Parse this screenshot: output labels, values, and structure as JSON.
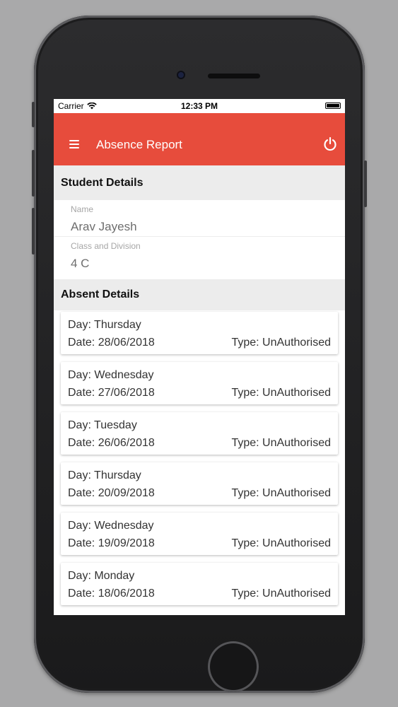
{
  "status_bar": {
    "carrier": "Carrier",
    "time": "12:33 PM"
  },
  "app_bar": {
    "title": "Absence Report",
    "menu_icon": "hamburger-menu-icon",
    "power_icon": "power-icon"
  },
  "student_details": {
    "header": "Student Details",
    "name_label": "Name",
    "name_value": "Arav Jayesh",
    "class_label": "Class and Division",
    "class_value": "4 C"
  },
  "absent_details": {
    "header": "Absent Details",
    "records": [
      {
        "day": "Day: Thursday",
        "date": "Date: 28/06/2018",
        "type": "Type: UnAuthorised"
      },
      {
        "day": "Day: Wednesday",
        "date": "Date: 27/06/2018",
        "type": "Type: UnAuthorised"
      },
      {
        "day": "Day: Tuesday",
        "date": "Date: 26/06/2018",
        "type": "Type: UnAuthorised"
      },
      {
        "day": "Day: Thursday",
        "date": "Date: 20/09/2018",
        "type": "Type: UnAuthorised"
      },
      {
        "day": "Day: Wednesday",
        "date": "Date: 19/09/2018",
        "type": "Type: UnAuthorised"
      },
      {
        "day": "Day: Monday",
        "date": "Date: 18/06/2018",
        "type": "Type: UnAuthorised"
      }
    ]
  },
  "colors": {
    "accent": "#e74c3c",
    "section_bg": "#ececec",
    "background": "#a9a9aa"
  }
}
